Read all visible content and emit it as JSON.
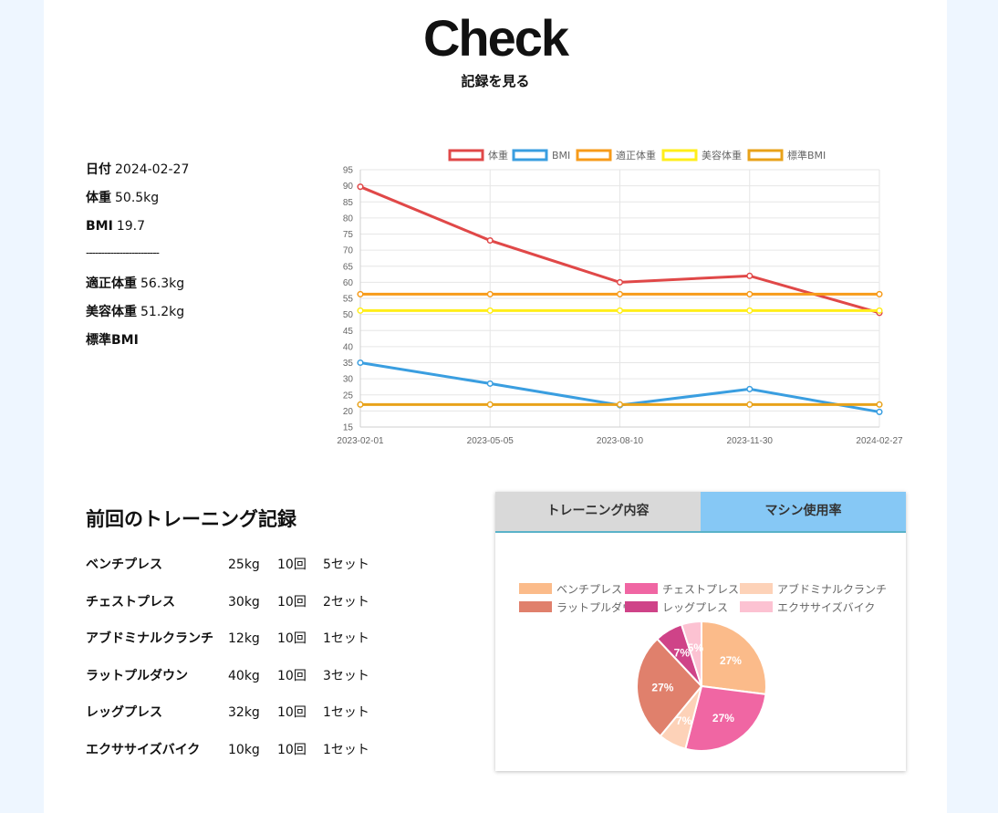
{
  "header": {
    "title": "Check",
    "subtitle": "記録を見る"
  },
  "stats": {
    "date_label": "日付",
    "date_value": "2024-02-27",
    "weight_label": "体重",
    "weight_value": "50.5kg",
    "bmi_label": "BMI",
    "bmi_value": "19.7",
    "separator": "------------------------",
    "ideal_label": "適正体重",
    "ideal_value": "56.3kg",
    "beauty_label": "美容体重",
    "beauty_value": "51.2kg",
    "std_bmi_label": "標準BMI",
    "std_bmi_value": ""
  },
  "colors": {
    "weight": "#e04848",
    "bmi": "#3a9ee0",
    "ideal": "#f79b1a",
    "beauty": "#ffee1a",
    "std_bmi": "#e8a21a",
    "tab_active": "#86c8f5",
    "tab_inactive": "#d9d9d9",
    "page_bg": "#eef6ff"
  },
  "chart_data": [
    {
      "type": "line",
      "x": [
        "2023-02-01",
        "2023-05-05",
        "2023-08-10",
        "2023-11-30",
        "2024-02-27"
      ],
      "ylim": [
        15,
        95
      ],
      "yticks": [
        15,
        20,
        25,
        30,
        35,
        40,
        45,
        50,
        55,
        60,
        65,
        70,
        75,
        80,
        85,
        90,
        95
      ],
      "grid": true,
      "legend_position": "top",
      "series": [
        {
          "name": "体重",
          "color": "#e04848",
          "values": [
            89.7,
            73.0,
            60.0,
            62.0,
            50.5
          ]
        },
        {
          "name": "BMI",
          "color": "#3a9ee0",
          "values": [
            35.0,
            28.5,
            21.8,
            26.8,
            19.7
          ]
        },
        {
          "name": "適正体重",
          "color": "#f79b1a",
          "values": [
            56.3,
            56.3,
            56.3,
            56.3,
            56.3
          ]
        },
        {
          "name": "美容体重",
          "color": "#ffee1a",
          "values": [
            51.2,
            51.2,
            51.2,
            51.2,
            51.2
          ]
        },
        {
          "name": "標準BMI",
          "color": "#e8a21a",
          "values": [
            22,
            22,
            22,
            22,
            22
          ]
        }
      ]
    },
    {
      "type": "pie",
      "legend_position": "top",
      "labels": [
        "ベンチプレス",
        "チェストプレス",
        "アブドミナルクランチ",
        "ラットプルダウン",
        "レッグプレス",
        "エクササイズバイク"
      ],
      "values": [
        27,
        27,
        7,
        27,
        7,
        5
      ],
      "value_labels": [
        "27%",
        "27%",
        "7%",
        "27%",
        "7%",
        "5%"
      ],
      "colors": [
        "#fbbb8a",
        "#f066a3",
        "#fdd2b8",
        "#e0806c",
        "#cf4388",
        "#fcc2d2"
      ]
    }
  ],
  "training": {
    "title": "前回のトレーニング記録",
    "rows": [
      {
        "name": "ベンチプレス",
        "weight": "25kg",
        "reps": "10回",
        "sets": "5セット"
      },
      {
        "name": "チェストプレス",
        "weight": "30kg",
        "reps": "10回",
        "sets": "2セット"
      },
      {
        "name": "アブドミナルクランチ",
        "weight": "12kg",
        "reps": "10回",
        "sets": "1セット"
      },
      {
        "name": "ラットプルダウン",
        "weight": "40kg",
        "reps": "10回",
        "sets": "3セット"
      },
      {
        "name": "レッグプレス",
        "weight": "32kg",
        "reps": "10回",
        "sets": "1セット"
      },
      {
        "name": "エクササイズバイク",
        "weight": "10kg",
        "reps": "10回",
        "sets": "1セット"
      }
    ]
  },
  "panel": {
    "tabs": [
      {
        "label": "トレーニング内容",
        "active": false
      },
      {
        "label": "マシン使用率",
        "active": true
      }
    ]
  }
}
